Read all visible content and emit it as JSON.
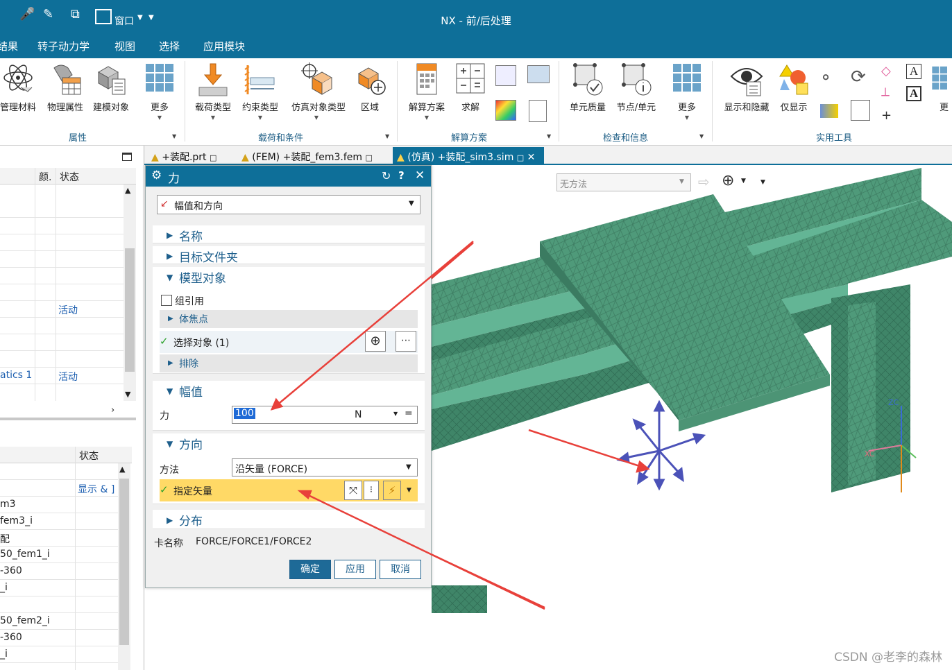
{
  "window": {
    "title": "NX - 前/后处理",
    "window_menu": "窗口"
  },
  "menubar": [
    "结果",
    "转子动力学",
    "视图",
    "选择",
    "应用模块"
  ],
  "ribbon": {
    "buttons": [
      "管理材料",
      "物理属性",
      "建模对象",
      "更多",
      "载荷类型",
      "约束类型",
      "仿真对象类型",
      "区域",
      "解算方案",
      "求解",
      "单元质量",
      "节点/单元",
      "更多",
      "显示和隐藏",
      "仅显示",
      "更"
    ],
    "groups": [
      "属性",
      "载荷和条件",
      "解算方案",
      "检查和信息",
      "实用工具"
    ]
  },
  "tabs": [
    "+装配.prt",
    "(FEM) +装配_fem3.fem",
    "(仿真) +装配_sim3.sim"
  ],
  "left_panel": {
    "top_headers": [
      "颜.",
      "状态"
    ],
    "status_rows": [
      "活动",
      "活动"
    ],
    "row_label": "atics 1",
    "bottom_header": "状态",
    "bottom_link": "显示 & ]",
    "bottom_rows": [
      "m3",
      "fem3_i",
      "配",
      "50_fem1_i",
      "-360",
      "_i",
      "",
      "50_fem2_i",
      "-360",
      "_i"
    ]
  },
  "dialog": {
    "title": "力",
    "type_value": "幅值和方向",
    "sections": {
      "name": "名称",
      "target_folder": "目标文件夹",
      "model_objects": "模型对象",
      "magnitude": "幅值",
      "direction": "方向",
      "distribution": "分布"
    },
    "group_ref_label": "组引用",
    "group_ref_checked": false,
    "focus_point": "体焦点",
    "select_objects": "选择对象 (1)",
    "exclude": "排除",
    "force_label": "力",
    "force_value": "100",
    "force_unit": "N",
    "method_label": "方法",
    "method_value": "沿矢量 (FORCE)",
    "specify_vector": "指定矢量",
    "card_name_label": "卡名称",
    "card_name_value": "FORCE/FORCE1/FORCE2",
    "ok": "确定",
    "apply": "应用",
    "cancel": "取消"
  },
  "viewport": {
    "method_dropdown": "无方法",
    "axis_labels": [
      "ZC",
      "XC",
      "Z"
    ]
  },
  "watermark": "CSDN @老李的森林",
  "colors": {
    "titlebar": "#0e6f99",
    "mesh": "#4f9a7a",
    "arrow": "#e8403a",
    "highlight": "#ffd966"
  }
}
